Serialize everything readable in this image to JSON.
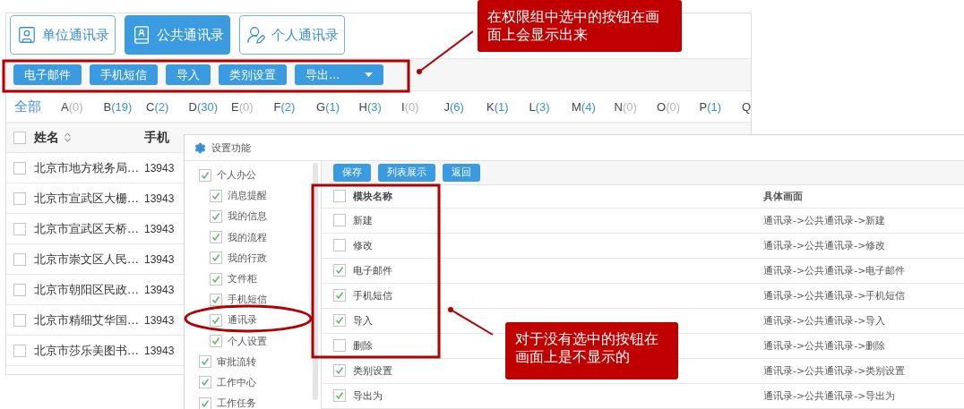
{
  "address_book_window": {
    "tabs": [
      {
        "label": "单位通讯录",
        "selected": false,
        "kind": "unit"
      },
      {
        "label": "公共通讯录",
        "selected": true,
        "kind": "public"
      },
      {
        "label": "个人通讯录",
        "selected": false,
        "kind": "personal"
      }
    ],
    "toolbar": [
      {
        "label": "电子邮件",
        "kind": "button"
      },
      {
        "label": "手机短信",
        "kind": "button"
      },
      {
        "label": "导入",
        "kind": "button"
      },
      {
        "label": "类别设置",
        "kind": "button"
      },
      {
        "label": "导出...",
        "kind": "dropdown"
      }
    ],
    "letter_filter": {
      "all": "全部",
      "letters": [
        {
          "letter": "A",
          "count": "(0)",
          "color": "#b3b3b3"
        },
        {
          "letter": "B",
          "count": "(19)",
          "color": "#3b8fd6"
        },
        {
          "letter": "C",
          "count": "(2)",
          "color": "#3b8fd6"
        },
        {
          "letter": "D",
          "count": "(30)",
          "color": "#3b8fd6"
        },
        {
          "letter": "E",
          "count": "(0)",
          "color": "#b3b3b3"
        },
        {
          "letter": "F",
          "count": "(2)",
          "color": "#3b8fd6"
        },
        {
          "letter": "G",
          "count": "(1)",
          "color": "#3b8fd6"
        },
        {
          "letter": "H",
          "count": "(3)",
          "color": "#3b8fd6"
        },
        {
          "letter": "I",
          "count": "(0)",
          "color": "#b3b3b3"
        },
        {
          "letter": "J",
          "count": "(6)",
          "color": "#3b8fd6"
        },
        {
          "letter": "K",
          "count": "(1)",
          "color": "#3b8fd6"
        },
        {
          "letter": "L",
          "count": "(3)",
          "color": "#3b8fd6"
        },
        {
          "letter": "M",
          "count": "(4)",
          "color": "#3b8fd6"
        },
        {
          "letter": "N",
          "count": "(0)",
          "color": "#b3b3b3"
        },
        {
          "letter": "O",
          "count": "(0)",
          "color": "#b3b3b3"
        },
        {
          "letter": "P",
          "count": "(1)",
          "color": "#3b8fd6"
        },
        {
          "letter": "Q"
        }
      ]
    },
    "table": {
      "header_checked": false,
      "columns": [
        "姓名",
        "手机"
      ],
      "rows": [
        {
          "checked": false,
          "name": "北京市地方税务局…",
          "mobile": "13943"
        },
        {
          "checked": false,
          "name": "北京市宣武区大栅…",
          "mobile": "13943"
        },
        {
          "checked": false,
          "name": "北京市宣武区天桥…",
          "mobile": "13943"
        },
        {
          "checked": false,
          "name": "北京市崇文区人民…",
          "mobile": "13943"
        },
        {
          "checked": false,
          "name": "北京市朝阳区民政…",
          "mobile": "13943"
        },
        {
          "checked": false,
          "name": "北京市精细艾华国…",
          "mobile": "13943"
        },
        {
          "checked": false,
          "name": "北京市莎乐美图书…",
          "mobile": "13943"
        }
      ]
    }
  },
  "settings_dialog": {
    "title": "设置功能",
    "tree": [
      {
        "label": "个人办公",
        "checked": true,
        "children": [
          {
            "label": "消息提醒",
            "checked": true
          },
          {
            "label": "我的信息",
            "checked": true
          },
          {
            "label": "我的流程",
            "checked": true
          },
          {
            "label": "我的行政",
            "checked": true
          },
          {
            "label": "文件柜",
            "checked": true
          },
          {
            "label": "手机短信",
            "checked": true
          },
          {
            "label": "通讯录",
            "checked": true
          },
          {
            "label": "个人设置",
            "checked": true
          }
        ]
      },
      {
        "label": "审批流转",
        "checked": true
      },
      {
        "label": "工作中心",
        "checked": true
      },
      {
        "label": "工作任务",
        "checked": true
      }
    ],
    "buttons": [
      "保存",
      "列表展示",
      "返回"
    ],
    "header_checked": false,
    "columns": [
      "模块名称",
      "具体画面"
    ],
    "rows": [
      {
        "checked": false,
        "module": "新建",
        "screen": "通讯录->公共通讯录->新建"
      },
      {
        "checked": false,
        "module": "修改",
        "screen": "通讯录->公共通讯录->修改"
      },
      {
        "checked": true,
        "module": "电子邮件",
        "screen": "通讯录->公共通讯录->电子邮件"
      },
      {
        "checked": true,
        "module": "手机短信",
        "screen": "通讯录->公共通讯录->手机短信"
      },
      {
        "checked": true,
        "module": "导入",
        "screen": "通讯录->公共通讯录->导入"
      },
      {
        "checked": false,
        "module": "删除",
        "screen": "通讯录->公共通讯录->删除"
      },
      {
        "checked": true,
        "module": "类别设置",
        "screen": "通讯录->公共通讯录->类别设置"
      },
      {
        "checked": true,
        "module": "导出为",
        "screen": "通讯录->公共通讯录->导出为"
      }
    ]
  },
  "annotations": [
    {
      "text": "在权限组中选中的按钮在画面上会显示出来"
    },
    {
      "text": "对于没有选中的按钮在画面上是不显示的"
    }
  ]
}
